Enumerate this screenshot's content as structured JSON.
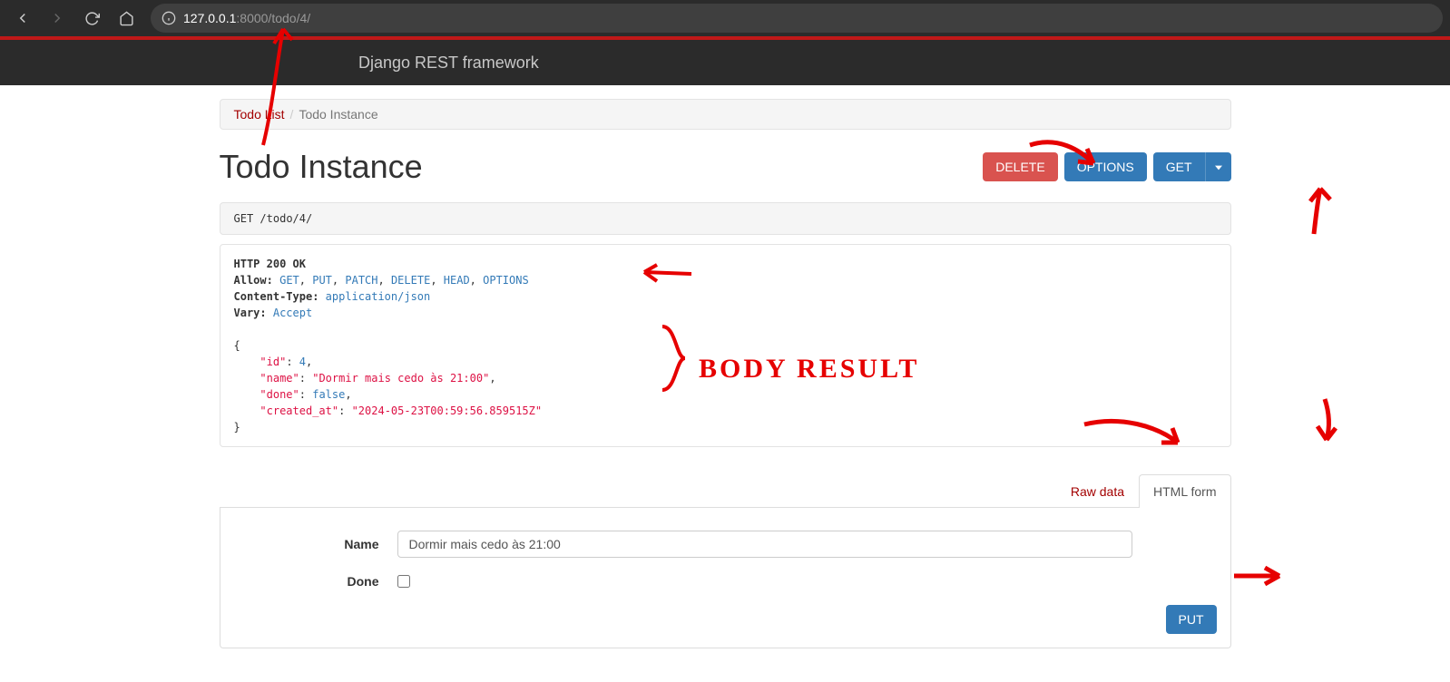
{
  "browser": {
    "url_host": "127.0.0.1",
    "url_rest": ":8000/todo/4/"
  },
  "navbar": {
    "brand": "Django REST framework"
  },
  "breadcrumb": {
    "parent": "Todo List",
    "current": "Todo Instance"
  },
  "page_title": "Todo Instance",
  "buttons": {
    "delete": "DELETE",
    "options": "OPTIONS",
    "get": "GET",
    "put": "PUT"
  },
  "request": {
    "method": "GET",
    "path": "/todo/4/"
  },
  "response": {
    "status_line": "HTTP 200 OK",
    "allow_label": "Allow:",
    "allow_methods": [
      "GET",
      "PUT",
      "PATCH",
      "DELETE",
      "HEAD",
      "OPTIONS"
    ],
    "content_type_label": "Content-Type:",
    "content_type_value": "application/json",
    "vary_label": "Vary:",
    "vary_value": "Accept",
    "body": {
      "id": 4,
      "name": "Dormir mais cedo às 21:00",
      "done": false,
      "created_at": "2024-05-23T00:59:56.859515Z"
    }
  },
  "tabs": {
    "raw": "Raw data",
    "html": "HTML form"
  },
  "form": {
    "name_label": "Name",
    "name_value": "Dormir mais cedo às 21:00",
    "done_label": "Done"
  },
  "annotations": {
    "body_result": "BODY  RESULT"
  }
}
